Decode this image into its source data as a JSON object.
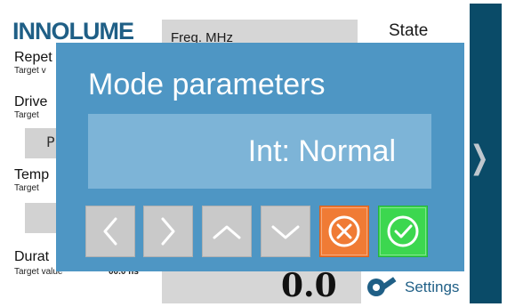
{
  "device": {
    "brand": "INNOLUME",
    "state_title": "State",
    "freq_label": "Freq. MHz",
    "labels": {
      "repet": "Repet",
      "repet_target": "Target v",
      "drive": "Drive",
      "drive_target": "Target",
      "drive_btn": "P",
      "temp": "Temp",
      "temp_target": "Target",
      "durat": "Durat",
      "durat_target": "Target value",
      "durat_value": "00.0 ns"
    },
    "bottom_value": "0.0",
    "settings_label": "Settings"
  },
  "modal": {
    "title": "Mode parameters",
    "value": "Int: Normal",
    "buttons": {
      "left": "chevron-left",
      "right": "chevron-right",
      "up": "chevron-up",
      "down": "chevron-down",
      "cancel": "close",
      "confirm": "check"
    },
    "colors": {
      "panel": "#4e96c4",
      "value_box": "#7db4d7",
      "cancel": "#f07b35",
      "confirm": "#3cd74f"
    }
  }
}
